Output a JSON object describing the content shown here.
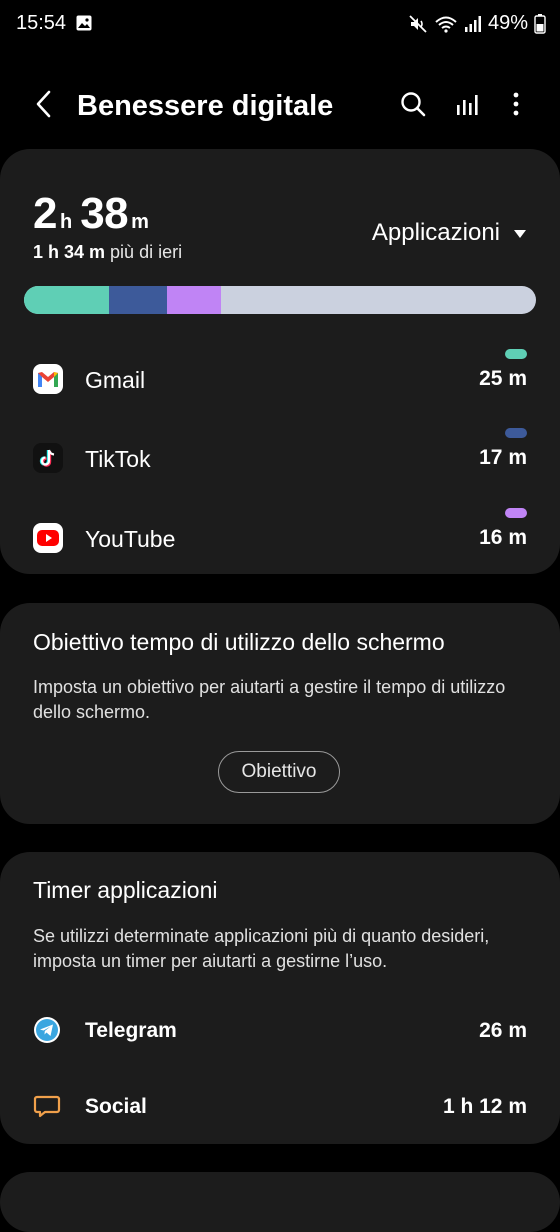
{
  "status_bar": {
    "time": "15:54",
    "battery": "49%",
    "icons": [
      "image-icon",
      "mute-icon",
      "wifi-icon",
      "signal-icon",
      "battery-icon"
    ]
  },
  "app_bar": {
    "title": "Benessere digitale",
    "icons": [
      "back-icon",
      "search-icon",
      "stats-icon",
      "more-icon"
    ]
  },
  "usage_summary": {
    "hours": "2",
    "hours_unit": "h",
    "minutes": "38",
    "minutes_unit": "m",
    "compare_amount": "1 h 34 m",
    "compare_text": " più di ieri",
    "filter_label": "Applicazioni",
    "bar_segments": [
      {
        "app": "Gmail",
        "fraction": 0.166,
        "color": "#5fcfb5"
      },
      {
        "app": "TikTok",
        "fraction": 0.113,
        "color": "#3d5a9a"
      },
      {
        "app": "YouTube",
        "fraction": 0.106,
        "color": "#c084f5"
      }
    ],
    "bar_rest_color": "#cbd1df"
  },
  "apps": [
    {
      "name": "Gmail",
      "time": "25 m",
      "color": "#5fcfb5",
      "icon": "gmail-icon"
    },
    {
      "name": "TikTok",
      "time": "17 m",
      "color": "#3d5a9a",
      "icon": "tiktok-icon"
    },
    {
      "name": "YouTube",
      "time": "16 m",
      "color": "#c084f5",
      "icon": "youtube-icon"
    }
  ],
  "screen_goal": {
    "title": "Obiettivo tempo di utilizzo dello schermo",
    "description": "Imposta un obiettivo per aiutarti a gestire il tempo di utilizzo dello schermo.",
    "button_label": "Obiettivo"
  },
  "app_timers": {
    "title": "Timer applicazioni",
    "description": "Se utilizzi determinate applicazioni più di quanto desideri, imposta un timer per aiutarti a gestirne l’uso.",
    "items": [
      {
        "name": "Telegram",
        "time": "26 m",
        "icon": "telegram-icon"
      },
      {
        "name": "Social",
        "time": "1 h 12 m",
        "icon": "chat-bubble-icon"
      }
    ]
  },
  "colors": {
    "background": "#000000",
    "card": "#1c1c1c",
    "social_icon": "#f0a04b",
    "telegram": "#3aa6e0"
  }
}
